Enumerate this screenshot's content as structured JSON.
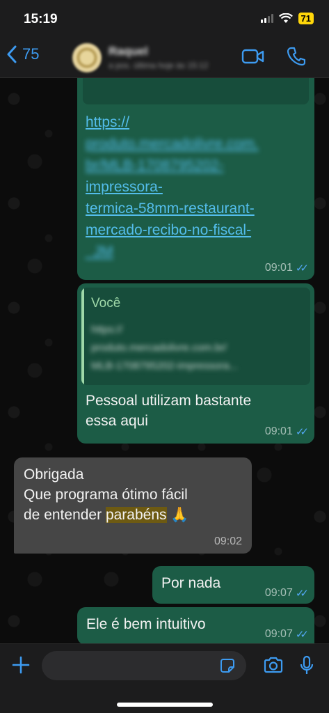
{
  "status_bar": {
    "time": "15:19",
    "battery": "71"
  },
  "header": {
    "back_count": "75",
    "contact_name": "Raquel",
    "contact_status": "a pos. última hoje às 15:12"
  },
  "messages": [
    {
      "direction": "outgoing",
      "link_lines": [
        "https://",
        "produto.mercadolivre.com.",
        "br/MLB-1708795202-",
        "impressora-",
        "termica-58mm-restaurant-",
        "mercado-recibo-no-fiscal-",
        "_JM"
      ],
      "time": "09:01"
    },
    {
      "direction": "outgoing",
      "quote_author": "Você",
      "quote_lines": [
        "https://",
        "produto.mercadolivre.com.br/",
        "MLB-1708795202-impressora..."
      ],
      "text_lines": [
        "Pessoal utilizam bastante",
        "essa aqui"
      ],
      "time": "09:01"
    },
    {
      "direction": "incoming",
      "text_lines": [
        "Obrigada",
        "Que programa ótimo fácil"
      ],
      "text_prefix": "de entender ",
      "highlight": "parabéns",
      "emoji": "🙏",
      "time": "09:02"
    },
    {
      "direction": "outgoing",
      "text": "Por nada",
      "time": "09:07"
    },
    {
      "direction": "outgoing",
      "text": "Ele é bem intuitivo",
      "time": "09:07"
    }
  ],
  "input": {
    "placeholder": ""
  },
  "icons": {
    "back": "chevron-left-icon",
    "video": "video-camera-icon",
    "call": "phone-icon",
    "plus": "plus-icon",
    "sticker": "sticker-icon",
    "camera": "camera-icon",
    "mic": "microphone-icon",
    "read": "double-check-icon"
  },
  "colors": {
    "accent": "#3d9bf1",
    "outgoing_bubble": "#1c5c46",
    "incoming_bubble": "#464646",
    "read_ticks": "#53a8f4",
    "quote_author": "#9fd8a8",
    "highlight": "#6d5a12",
    "battery": "#ffd60a"
  }
}
